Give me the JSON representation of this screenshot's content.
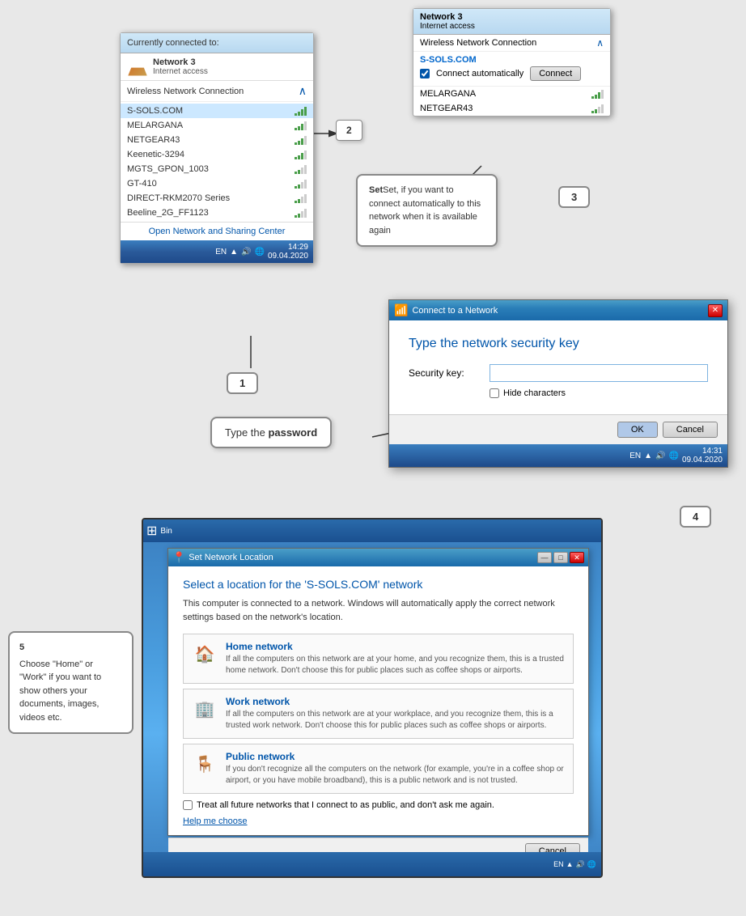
{
  "steps": {
    "step1": {
      "label": "1",
      "header": "Currently connected to:",
      "network_name": "Network 3",
      "network_sub": "Internet access",
      "wifi_section": "Wireless Network Connection",
      "wifi_list": [
        {
          "name": "S-SOLS.COM",
          "signal": 4
        },
        {
          "name": "MELARGANA",
          "signal": 3
        },
        {
          "name": "NETGEAR43",
          "signal": 3
        },
        {
          "name": "Keenetic-3294",
          "signal": 3
        },
        {
          "name": "MGTS_GPON_1003",
          "signal": 2
        },
        {
          "name": "GT-410",
          "signal": 2
        },
        {
          "name": "DIRECT-RKM2070 Series",
          "signal": 2
        },
        {
          "name": "Beeline_2G_FF1123",
          "signal": 2
        }
      ],
      "footer_link": "Open Network and Sharing Center",
      "taskbar_time": "14:29",
      "taskbar_date": "09.04.2020",
      "taskbar_lang": "EN"
    },
    "step2": {
      "label": "2"
    },
    "step3": {
      "label": "3",
      "network3_label": "Network 3",
      "network3_sub": "Internet access",
      "wifi_section": "Wireless Network Connection",
      "ssols_label": "S-SOLS.COM",
      "connect_auto_label": "Connect automatically",
      "connect_button": "Connect",
      "other_network": "MELARGANA"
    },
    "step3_callout": {
      "text": "Set, if you want to connect automatically to this network when it is available again"
    },
    "step4": {
      "label": "4",
      "dialog_title": "Connect to a Network",
      "heading": "Type the network security key",
      "security_key_label": "Security key:",
      "hide_characters": "Hide characters",
      "ok_button": "OK",
      "cancel_button": "Cancel",
      "taskbar_time": "14:31",
      "taskbar_date": "09.04.2020",
      "taskbar_lang": "EN"
    },
    "type_password": {
      "text_before": "Type the ",
      "text_bold": "password"
    },
    "step5": {
      "label": "5",
      "callout_title": "5",
      "callout_text": "Choose \"Home\" or \"Work\" if you want to show others your documents, images, videos etc.",
      "dialog_title": "Set Network Location",
      "heading": "Select a location for the 'S-SOLS.COM' network",
      "desc": "This computer is connected to a network. Windows will automatically apply the correct network settings based on the network's location.",
      "home_title": "Home network",
      "home_desc": "If all the computers on this network are at your home, and you recognize them, this is a trusted home network.  Don't choose this for public places such as coffee shops or airports.",
      "work_title": "Work network",
      "work_desc": "If all the computers on this network are at your workplace, and you recognize them, this is a trusted work network.  Don't choose this for public places such as coffee shops or airports.",
      "public_title": "Public network",
      "public_desc": "If you don't recognize all the computers on the network (for example, you're in a coffee shop or airport, or you have mobile broadband), this is a public network and is not trusted.",
      "checkbox_label": "Treat all future networks that I connect to as public, and don't ask me again.",
      "help_link": "Help me choose",
      "cancel_button": "Cancel"
    }
  }
}
